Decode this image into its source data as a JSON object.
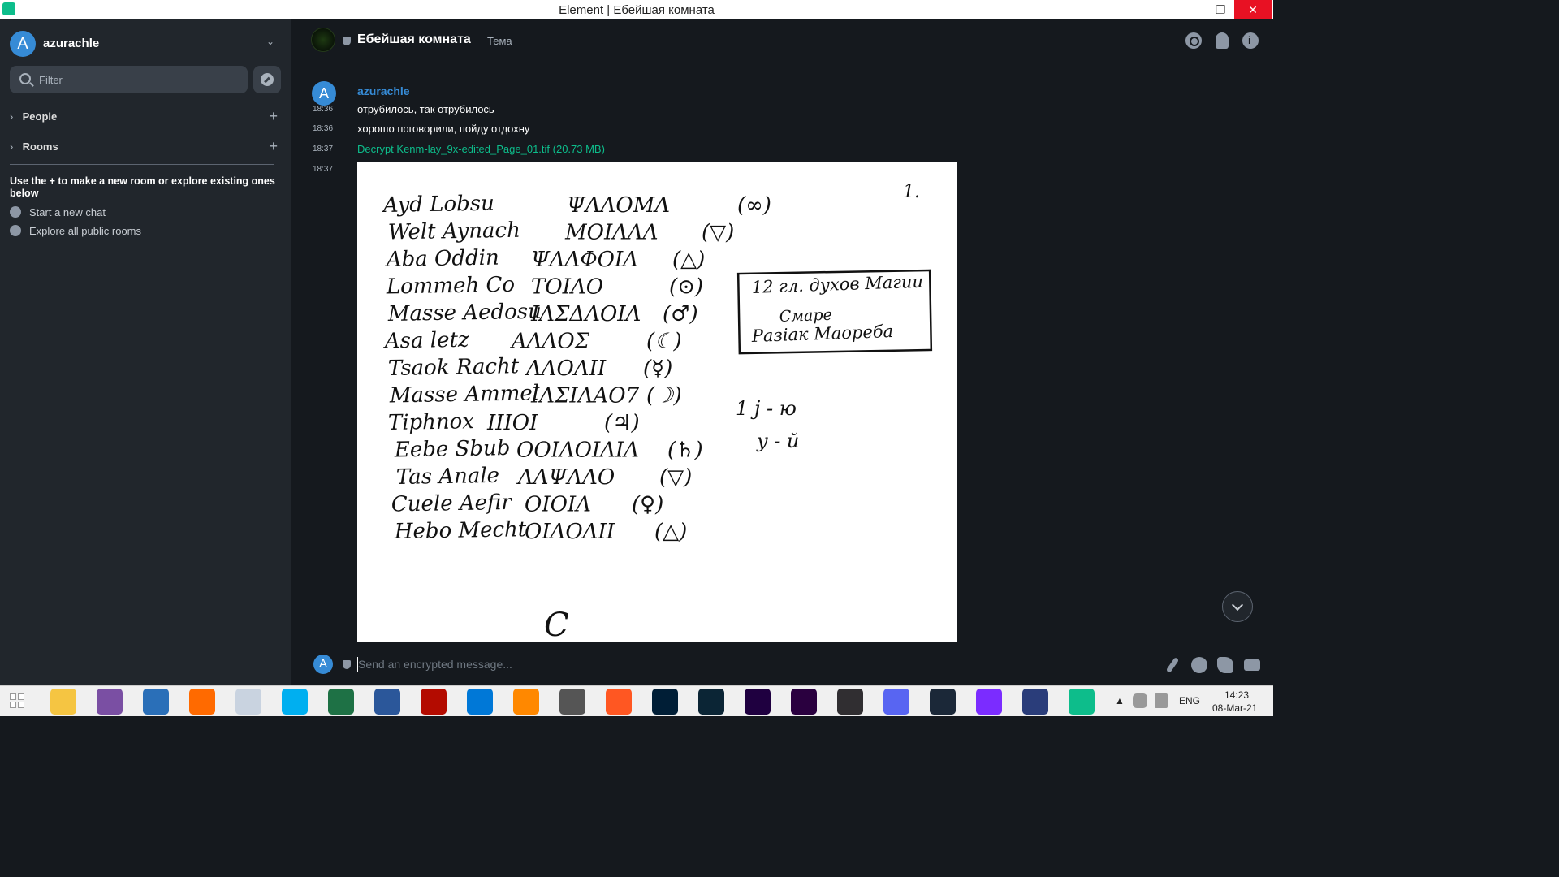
{
  "window": {
    "title": "Element | Ебейшая комната"
  },
  "sidebar": {
    "user_initial": "A",
    "user_name": "azurachle",
    "filter_placeholder": "Filter",
    "sections": [
      {
        "label": "People"
      },
      {
        "label": "Rooms"
      }
    ],
    "hint": "Use the + to make a new room or explore existing ones below",
    "links": [
      {
        "label": "Start a new chat"
      },
      {
        "label": "Explore all public rooms"
      }
    ]
  },
  "room": {
    "name": "Ебейшая комната",
    "topic": "Тема"
  },
  "timeline": {
    "sender_initial": "A",
    "sender": "azurachle",
    "messages": [
      {
        "time": "18:36",
        "text": "отрубилось, так отрубилось"
      },
      {
        "time": "18:36",
        "text": "хорошо поговорили, пойду отдохну"
      },
      {
        "time": "18:37",
        "text": "Decrypt Kenm-lay_9x-edited_Page_01.tif (20.73 MB)"
      },
      {
        "time": "18:37",
        "text": ""
      }
    ]
  },
  "composer": {
    "avatar_initial": "A",
    "placeholder": "Send an encrypted message..."
  },
  "taskbar": {
    "language": "ENG",
    "time": "14:23",
    "date": "08-Mar-21",
    "apps": [
      "file-explorer",
      "tor",
      "browser",
      "firefox",
      "moon",
      "skype",
      "excel",
      "word",
      "acrobat",
      "vscode",
      "vlc",
      "downloader",
      "sublime",
      "photoshop",
      "lightroom",
      "after-effects",
      "premiere",
      "obs",
      "discord",
      "steam",
      "cortana-ring",
      "keepass",
      "element"
    ]
  },
  "colors": {
    "accent": "#0dbd8b",
    "link": "#368bd6",
    "background": "#15191e",
    "sidebar": "#21262c"
  },
  "document_image": {
    "page_number": "1.",
    "lines": [
      {
        "name": "Ayd Lobsu",
        "symbol": "(∞)"
      },
      {
        "name": "Welt Aynach",
        "symbol": "(▽)"
      },
      {
        "name": "Aba Oddin",
        "symbol": "(△)"
      },
      {
        "name": "Lommeh Co",
        "symbol": "(⊙)"
      },
      {
        "name": "Masse Aedosu",
        "symbol": "(♂)"
      },
      {
        "name": "Asa letz",
        "symbol": "(☾)"
      },
      {
        "name": "Tsaok Racht",
        "symbol": "(☿)"
      },
      {
        "name": "Masse Ammel",
        "symbol": "(☽)"
      },
      {
        "name": "Tiphnox",
        "symbol": "(♃)"
      },
      {
        "name": "Eebe Sbub",
        "symbol": "(♄)"
      },
      {
        "name": "Tas Anale",
        "symbol": "(▽)"
      },
      {
        "name": "Cuele Aefir",
        "symbol": "(♀)"
      },
      {
        "name": "Hebo Mecht",
        "symbol": "(△)"
      }
    ],
    "box_lines": [
      "12 гл. духов Магии",
      "Смарe",
      "Разіак Маореба"
    ],
    "notes": [
      "1  j - ю",
      "y - й"
    ],
    "footer_glyph": "C"
  }
}
